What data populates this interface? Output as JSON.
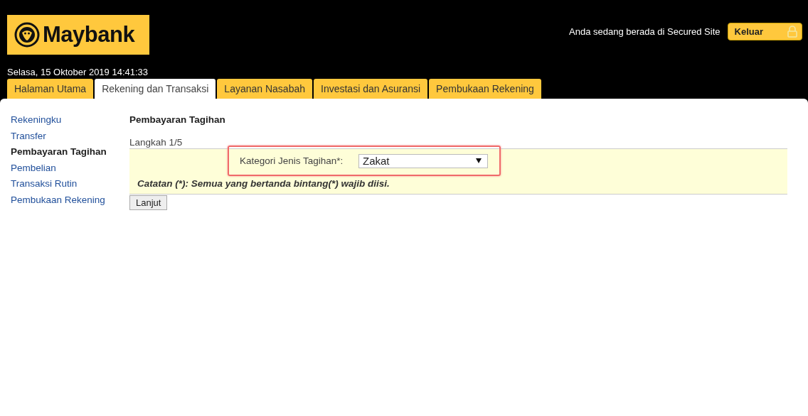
{
  "header": {
    "logo": "Maybank",
    "secure_notice": "Anda sedang berada di Secured Site",
    "logout_button": "Keluar",
    "datetime": "Selasa, 15 Oktober 2019 14:41:33"
  },
  "tabs": [
    {
      "label": "Halaman Utama",
      "selected": false
    },
    {
      "label": "Rekening dan Transaksi",
      "selected": true
    },
    {
      "label": "Layanan Nasabah",
      "selected": false
    },
    {
      "label": "Investasi dan Asuransi",
      "selected": false
    },
    {
      "label": "Pembukaan Rekening",
      "selected": false
    }
  ],
  "sidebar": {
    "items": [
      {
        "label": "Rekeningku",
        "selected": false
      },
      {
        "label": "Transfer",
        "selected": false
      },
      {
        "label": "Pembayaran Tagihan",
        "selected": true
      },
      {
        "label": "Pembelian",
        "selected": false
      },
      {
        "label": "Transaksi Rutin",
        "selected": false
      },
      {
        "label": "Pembukaan Rekening",
        "selected": false
      }
    ]
  },
  "content": {
    "title": "Pembayaran Tagihan",
    "step": "Langkah 1/5",
    "field_label": "Kategori Jenis Tagihan*:",
    "field_value": "Zakat",
    "highlighted": true,
    "note": "Catatan (*): Semua yang bertanda bintang(*) wajib diisi.",
    "submit_button": "Lanjut"
  }
}
